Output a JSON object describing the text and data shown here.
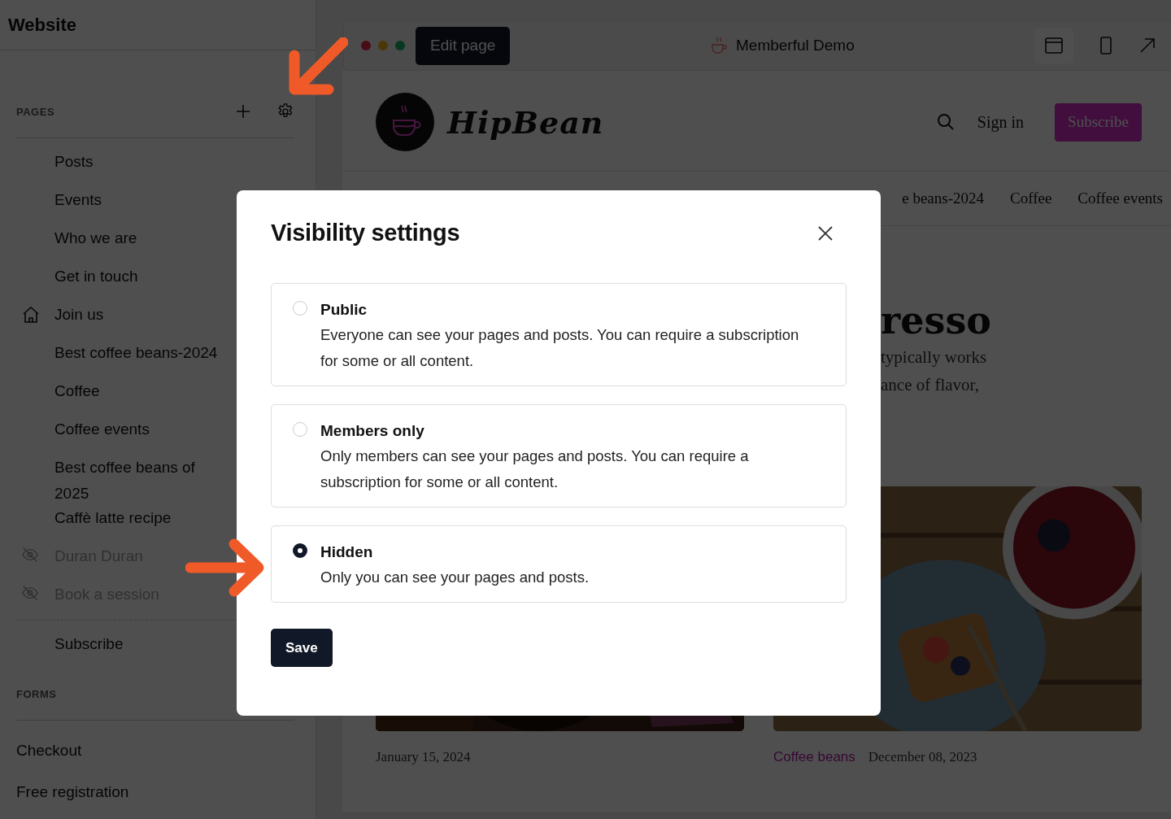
{
  "sidebar": {
    "title": "Website",
    "pages": {
      "heading": "PAGES",
      "items": [
        {
          "label": "Posts",
          "kind": "plain",
          "hidden": false
        },
        {
          "label": "Events",
          "kind": "plain",
          "hidden": false
        },
        {
          "label": "Who we are",
          "kind": "plain",
          "hidden": false
        },
        {
          "label": "Get in touch",
          "kind": "plain",
          "hidden": false
        },
        {
          "label": "Join us",
          "kind": "home",
          "hidden": false
        },
        {
          "label": "Best coffee beans-2024",
          "kind": "plain",
          "hidden": false
        },
        {
          "label": "Coffee",
          "kind": "plain",
          "hidden": false
        },
        {
          "label": "Coffee events",
          "kind": "plain",
          "hidden": false
        },
        {
          "label": "Best coffee beans of 2025",
          "kind": "plain",
          "hidden": false
        },
        {
          "label": "Caffè latte recipe",
          "kind": "plain",
          "hidden": false
        },
        {
          "label": "Duran Duran",
          "kind": "plain",
          "hidden": true
        },
        {
          "label": "Book a session",
          "kind": "plain",
          "hidden": true
        }
      ],
      "extra_items": [
        "Subscribe"
      ]
    },
    "forms": {
      "heading": "FORMS",
      "items": [
        "Checkout",
        "Free registration"
      ]
    }
  },
  "browser": {
    "edit_button": "Edit page",
    "site_title": "Memberful Demo"
  },
  "site": {
    "logo": "HipBean",
    "sign_in": "Sign in",
    "subscribe": "Subscribe",
    "nav": [
      "e beans-2024",
      "Coffee",
      "Coffee events"
    ],
    "hero": {
      "title": "resso",
      "lines": [
        "typically works",
        "ance of flavor,"
      ]
    },
    "posts": [
      {
        "date": "January 15, 2024"
      },
      {
        "category": "Coffee beans",
        "date": "December 08, 2023"
      }
    ]
  },
  "modal": {
    "title": "Visibility settings",
    "options": [
      {
        "title": "Public",
        "description": "Everyone can see your pages and posts. You can require a subscription for some or all content.",
        "selected": false
      },
      {
        "title": "Members only",
        "description": "Only members can see your pages and posts. You can require a subscription for some or all content.",
        "selected": false
      },
      {
        "title": "Hidden",
        "description": "Only you can see your pages and posts.",
        "selected": true
      }
    ],
    "save": "Save"
  }
}
